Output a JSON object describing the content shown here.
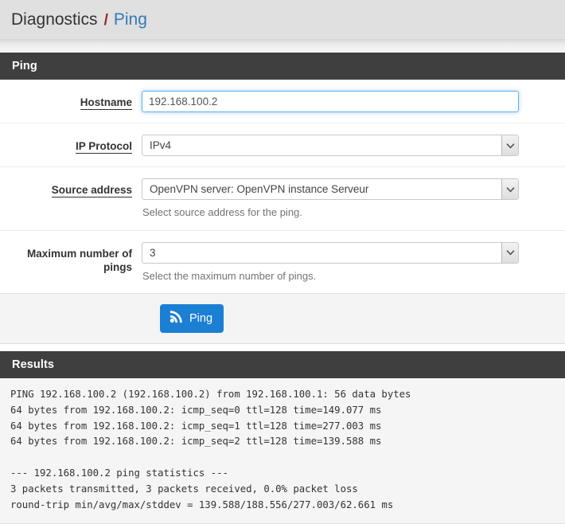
{
  "breadcrumb": {
    "root": "Diagnostics",
    "separator": "/",
    "current": "Ping"
  },
  "ping_panel": {
    "title": "Ping",
    "fields": {
      "hostname": {
        "label": "Hostname",
        "value": "192.168.100.2",
        "placeholder": ""
      },
      "ip_protocol": {
        "label": "IP Protocol",
        "value": "IPv4"
      },
      "source_address": {
        "label": "Source address",
        "value": "OpenVPN server: OpenVPN instance Serveur",
        "help": "Select source address for the ping."
      },
      "max_pings": {
        "label": "Maximum number of pings",
        "value": "3",
        "help": "Select the maximum number of pings."
      }
    },
    "submit": {
      "label": "Ping",
      "icon": "rss-icon",
      "color": "#1b7fd4"
    }
  },
  "results_panel": {
    "title": "Results",
    "output": "PING 192.168.100.2 (192.168.100.2) from 192.168.100.1: 56 data bytes\n64 bytes from 192.168.100.2: icmp_seq=0 ttl=128 time=149.077 ms\n64 bytes from 192.168.100.2: icmp_seq=1 ttl=128 time=277.003 ms\n64 bytes from 192.168.100.2: icmp_seq=2 ttl=128 time=139.588 ms\n\n--- 192.168.100.2 ping statistics ---\n3 packets transmitted, 3 packets received, 0.0% packet loss\nround-trip min/avg/max/stddev = 139.588/188.556/277.003/62.661 ms"
  },
  "colors": {
    "panel_heading_bg": "#3f3f3f",
    "breadcrumb_link": "#337ab7",
    "breadcrumb_separator": "#9b2226",
    "button_primary": "#1b7fd4",
    "input_focus_border": "#66afe9"
  }
}
